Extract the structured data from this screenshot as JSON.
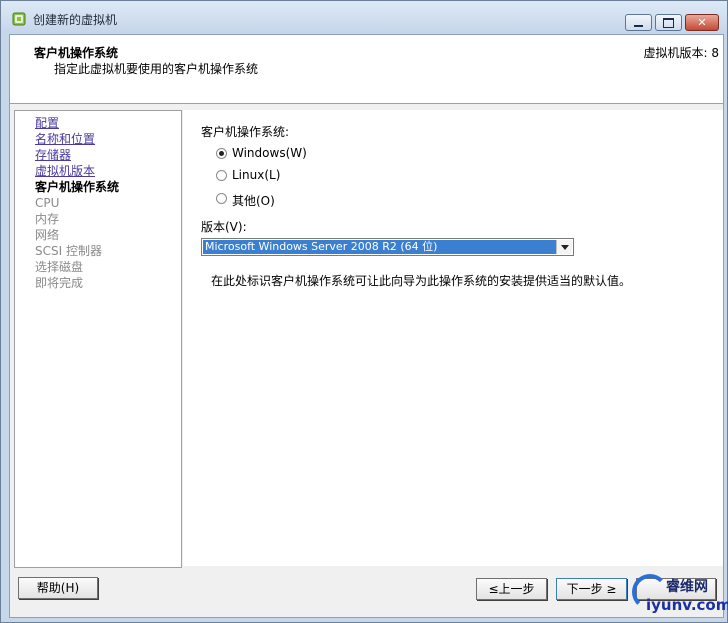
{
  "window": {
    "title": "创建新的虚拟机"
  },
  "header": {
    "title": "客户机操作系统",
    "subtitle": "指定此虚拟机要使用的客户机操作系统",
    "version": "虚拟机版本: 8"
  },
  "nav": {
    "items": [
      {
        "label": "配置",
        "state": "link"
      },
      {
        "label": "名称和位置",
        "state": "link"
      },
      {
        "label": "存储器",
        "state": "link"
      },
      {
        "label": "虚拟机版本",
        "state": "link"
      },
      {
        "label": "客户机操作系统",
        "state": "current"
      },
      {
        "label": "CPU",
        "state": "disabled"
      },
      {
        "label": "内存",
        "state": "disabled"
      },
      {
        "label": "网络",
        "state": "disabled"
      },
      {
        "label": "SCSI 控制器",
        "state": "disabled"
      },
      {
        "label": "选择磁盘",
        "state": "disabled"
      },
      {
        "label": "即将完成",
        "state": "disabled"
      }
    ]
  },
  "content": {
    "os_label": "客户机操作系统:",
    "options": [
      {
        "label": "Windows(W)",
        "checked": true
      },
      {
        "label": "Linux(L)",
        "checked": false
      },
      {
        "label": "其他(O)",
        "checked": false
      }
    ],
    "version_label": "版本(V):",
    "version_value": "Microsoft Windows Server 2008 R2 (64 位)",
    "description": "在此处标识客户机操作系统可让此向导为此操作系统的安装提供适当的默认值。"
  },
  "buttons": {
    "help": "帮助(H)",
    "back": "≤上一步",
    "next": "下一步 ≥",
    "cancel": ""
  },
  "watermark": {
    "brand": "睿维网",
    "url": "iyunv.com"
  },
  "colors": {
    "link": "#4a3aa0",
    "selection": "#3b7fd0",
    "title_bar": "#c6d6ea"
  }
}
